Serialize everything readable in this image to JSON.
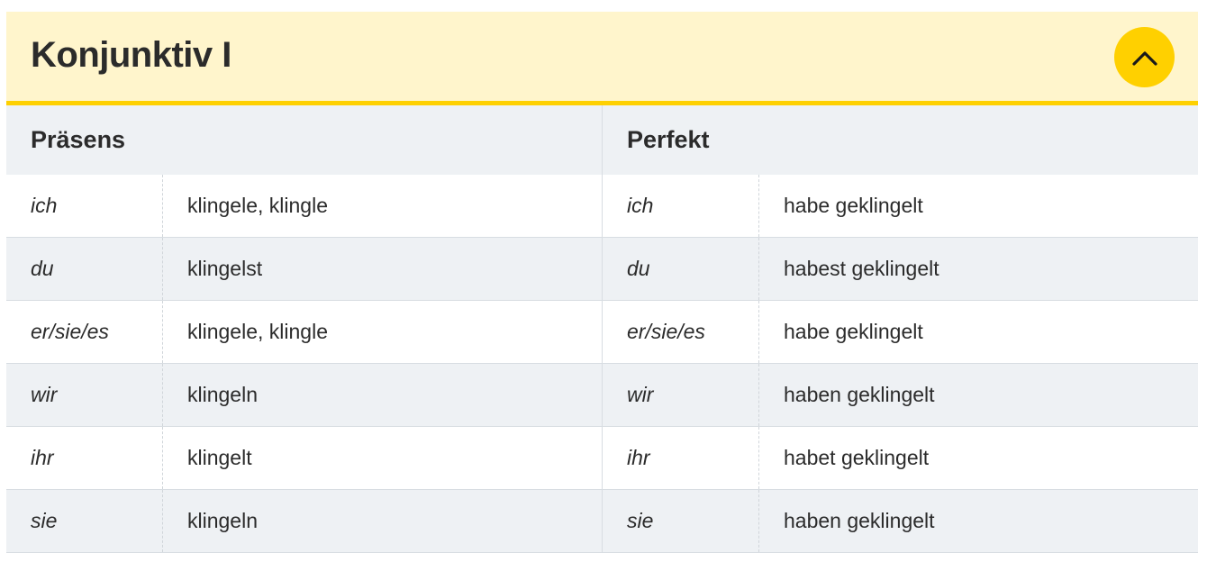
{
  "section": {
    "title": "Konjunktiv I",
    "collapse_icon": "chevron-up-icon",
    "accent_color": "#fed000",
    "header_bg": "#fff5cc"
  },
  "tables": [
    {
      "heading": "Präsens",
      "rows": [
        {
          "pronoun": "ich",
          "form": "klingele, klingle"
        },
        {
          "pronoun": "du",
          "form": "klingelst"
        },
        {
          "pronoun": "er/sie/es",
          "form": "klingele, klingle"
        },
        {
          "pronoun": "wir",
          "form": "klingeln"
        },
        {
          "pronoun": "ihr",
          "form": "klingelt"
        },
        {
          "pronoun": "sie",
          "form": "klingeln"
        }
      ]
    },
    {
      "heading": "Perfekt",
      "rows": [
        {
          "pronoun": "ich",
          "form": "habe geklingelt"
        },
        {
          "pronoun": "du",
          "form": "habest geklingelt"
        },
        {
          "pronoun": "er/sie/es",
          "form": "habe geklingelt"
        },
        {
          "pronoun": "wir",
          "form": "haben geklingelt"
        },
        {
          "pronoun": "ihr",
          "form": "habet geklingelt"
        },
        {
          "pronoun": "sie",
          "form": "haben geklingelt"
        }
      ]
    }
  ]
}
